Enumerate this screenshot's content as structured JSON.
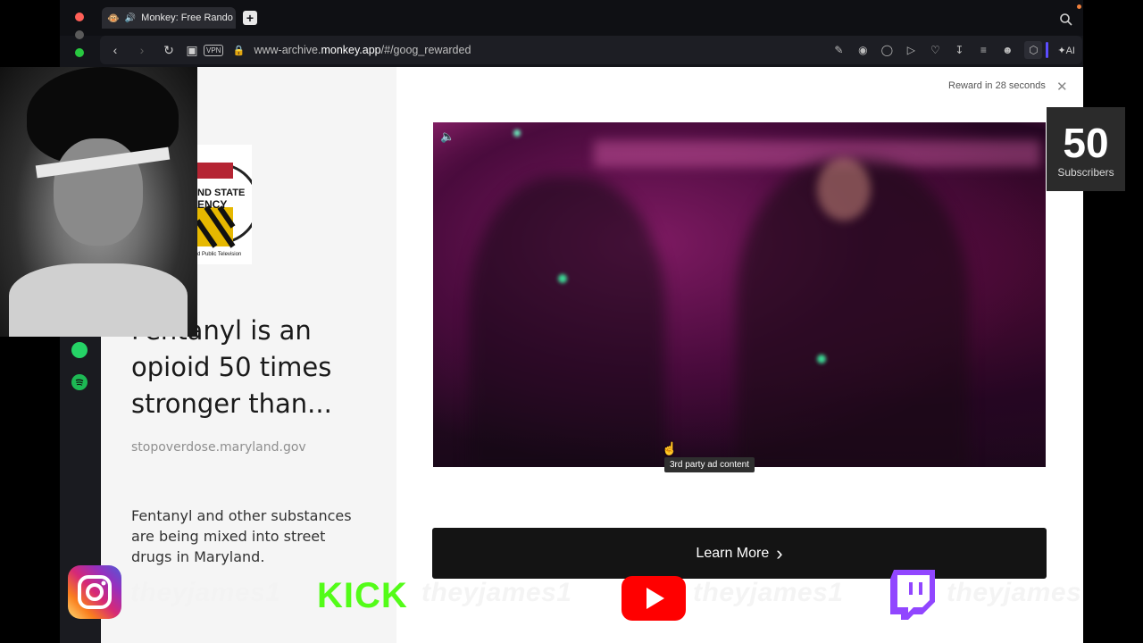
{
  "browser": {
    "tab_title": "Monkey: Free Rando",
    "url_prefix": "www-archive.",
    "url_domain": "monkey.app",
    "url_path": "/#/goog_rewarded",
    "vpn_label": "VPN",
    "ai_label": "AI",
    "sidebar_icons": [
      "whatsapp-icon",
      "spotify-icon"
    ]
  },
  "ad": {
    "reward_text": "Reward in 28 seconds",
    "headline_first_word": "Fentanyl",
    "headline_visible": "Fentanyl is an opioid 50 times stronger than...",
    "domain": "stopoverdose.maryland.gov",
    "body": "Fentanyl and other substances are being mixed into street drugs in Maryland.",
    "tooltip": "3rd party ad content",
    "learn_more": "Learn More",
    "logo_text_1": "ND STATE",
    "logo_text_2": "ENCY",
    "logo_text_3": "d Public Television"
  },
  "stream_overlay": {
    "subscribers_count": "50",
    "subscribers_label": "Subscribers",
    "handle": "theyjames1",
    "kick_label": "KICK"
  },
  "colors": {
    "tab_accent": "#ff2c72",
    "kick_green": "#53fc18",
    "youtube_red": "#ff0000",
    "twitch_purple": "#9146ff"
  }
}
